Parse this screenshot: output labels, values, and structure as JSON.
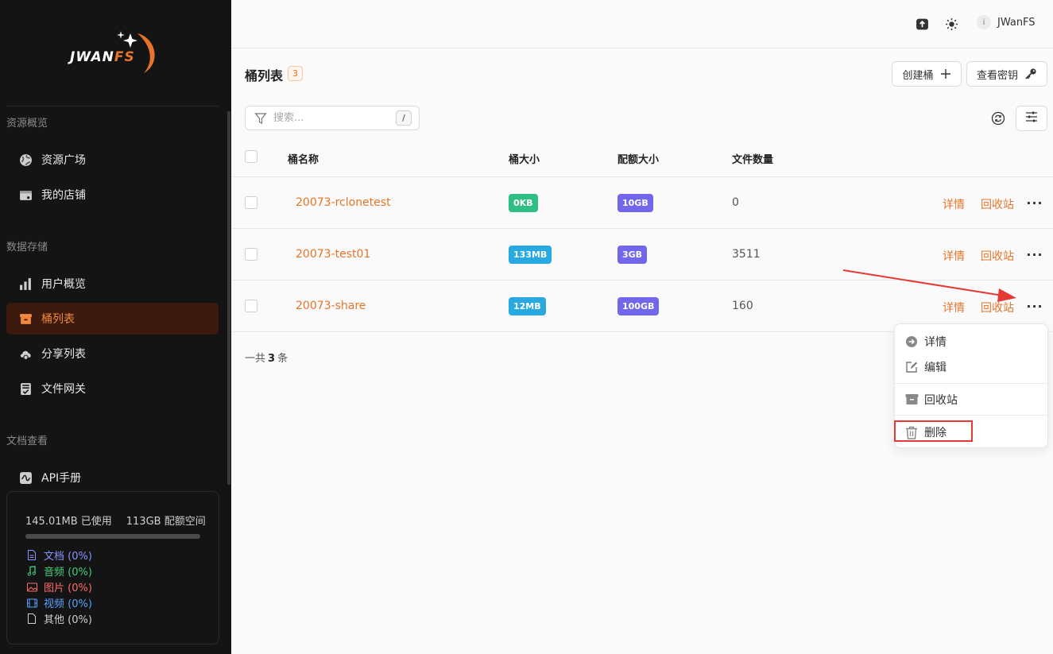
{
  "sidebar": {
    "logo": {
      "text_main": "JWAN",
      "text_accent": "FS"
    },
    "sections": [
      {
        "title": "资源概览"
      },
      {
        "title": "数据存储"
      },
      {
        "title": "文档查看"
      }
    ],
    "items": [
      {
        "label": "资源广场",
        "icon": "globe-icon"
      },
      {
        "label": "我的店铺",
        "icon": "store-icon"
      },
      {
        "label": "用户概览",
        "icon": "bar-chart-icon"
      },
      {
        "label": "桶列表",
        "icon": "bucket-icon",
        "active": true
      },
      {
        "label": "分享列表",
        "icon": "cloud-share-icon"
      },
      {
        "label": "文件网关",
        "icon": "gateway-icon"
      },
      {
        "label": "API手册",
        "icon": "api-icon"
      }
    ],
    "storage": {
      "used": "145.01MB 已使用",
      "quota": "113GB 配额空间",
      "used_fraction": 0.0,
      "types": [
        {
          "label": "文档 (0%)",
          "color": "#8a94ff",
          "icon": "document-icon"
        },
        {
          "label": "音频 (0%)",
          "color": "#3ecf7a",
          "icon": "music-icon"
        },
        {
          "label": "图片 (0%)",
          "color": "#ff6b6b",
          "icon": "image-icon"
        },
        {
          "label": "视频 (0%)",
          "color": "#5aa2ff",
          "icon": "video-icon"
        },
        {
          "label": "其他 (0%)",
          "color": "#cfcfcf",
          "icon": "file-icon"
        }
      ]
    }
  },
  "topbar": {
    "icons": [
      "upload-icon",
      "sun-icon"
    ],
    "avatar_letter": "i",
    "username": "JWanFS"
  },
  "page": {
    "title": "桶列表",
    "count": "3",
    "create_label": "创建桶",
    "key_label": "查看密钥",
    "search_placeholder": "搜索...",
    "search_shortcut": "/"
  },
  "table": {
    "columns": [
      "桶名称",
      "桶大小",
      "配额大小",
      "文件数量"
    ],
    "rows": [
      {
        "name": "20073-rclonetest",
        "size": "0KB",
        "size_color": "#2fbf85",
        "quota": "10GB",
        "files": "0"
      },
      {
        "name": "20073-test01",
        "size": "133MB",
        "size_color": "#29a9e1",
        "quota": "3GB",
        "files": "3511"
      },
      {
        "name": "20073-share",
        "size": "12MB",
        "size_color": "#29a9e1",
        "quota": "100GB",
        "files": "160"
      }
    ],
    "quota_color": "#7266ea",
    "action_detail": "详情",
    "action_recycle": "回收站",
    "total_prefix": "一共",
    "total_count": "3",
    "total_suffix": "条"
  },
  "menu": {
    "items": [
      {
        "label": "详情",
        "icon": "arrow-circle-icon"
      },
      {
        "label": "编辑",
        "icon": "edit-icon"
      },
      {
        "label": "回收站",
        "icon": "archive-icon"
      },
      {
        "label": "删除",
        "icon": "trash-icon"
      }
    ]
  },
  "colors": {
    "accent": "#e8742a",
    "sidebar_bg": "#141414",
    "active_bg": "#3d1a0e",
    "annotation_red": "#e53935"
  }
}
